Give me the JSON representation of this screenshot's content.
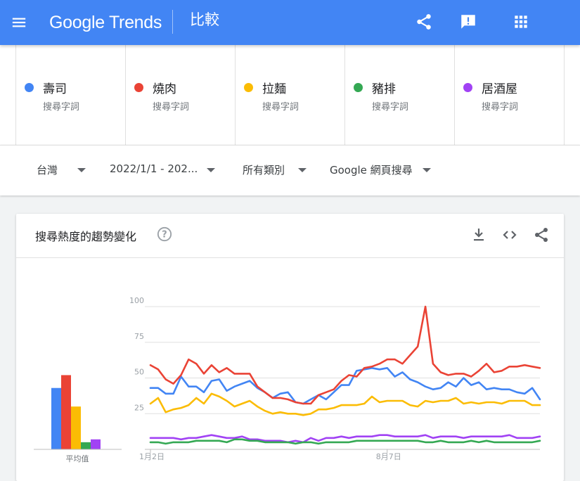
{
  "header": {
    "logo_text": "Google Trends",
    "page_title": "比較",
    "icons": [
      "menu-icon",
      "share-icon",
      "feedback-icon",
      "apps-icon"
    ]
  },
  "terms": [
    {
      "name": "壽司",
      "sub": "搜尋字詞",
      "color": "#4285f4"
    },
    {
      "name": "燒肉",
      "sub": "搜尋字詞",
      "color": "#ea4335"
    },
    {
      "name": "拉麵",
      "sub": "搜尋字詞",
      "color": "#fbbc04"
    },
    {
      "name": "豬排",
      "sub": "搜尋字詞",
      "color": "#34a853"
    },
    {
      "name": "居酒屋",
      "sub": "搜尋字詞",
      "color": "#a142f4"
    }
  ],
  "filters": [
    {
      "label": "台灣"
    },
    {
      "label": "2022/1/1 - 202..."
    },
    {
      "label": "所有類別"
    },
    {
      "label": "Google 網頁搜尋"
    }
  ],
  "card": {
    "title": "搜尋熱度的趨勢變化",
    "icons": [
      "help-icon",
      "download-icon",
      "embed-icon",
      "share-icon"
    ]
  },
  "chart_data": {
    "type": "line",
    "ylim": [
      0,
      100
    ],
    "yticks": [
      25,
      50,
      75,
      100
    ],
    "x_labels": [
      {
        "index": 0,
        "text": "1月2日"
      },
      {
        "index": 31,
        "text": "8月7日"
      }
    ],
    "averages_label": "平均值",
    "averages": [
      43,
      52,
      30,
      5,
      7
    ],
    "series": [
      {
        "name": "壽司",
        "color": "#4285f4",
        "values": [
          43,
          43,
          39,
          39,
          51,
          44,
          44,
          40,
          48,
          49,
          41,
          44,
          46,
          48,
          43,
          40,
          36,
          39,
          40,
          33,
          32,
          35,
          38,
          35,
          40,
          45,
          45,
          55,
          56,
          57,
          56,
          57,
          51,
          54,
          49,
          47,
          44,
          42,
          43,
          47,
          44,
          50,
          45,
          47,
          42,
          43,
          42,
          42,
          40,
          39,
          43,
          35
        ]
      },
      {
        "name": "燒肉",
        "color": "#ea4335",
        "values": [
          59,
          56,
          49,
          46,
          52,
          63,
          60,
          53,
          59,
          54,
          57,
          53,
          53,
          53,
          44,
          40,
          36,
          36,
          35,
          33,
          32,
          32,
          38,
          40,
          42,
          48,
          52,
          51,
          57,
          58,
          60,
          63,
          63,
          60,
          66,
          72,
          100,
          60,
          54,
          52,
          53,
          53,
          51,
          55,
          60,
          54,
          55,
          58,
          58,
          59,
          58,
          57
        ]
      },
      {
        "name": "拉麵",
        "color": "#fbbc04",
        "values": [
          32,
          36,
          26,
          28,
          29,
          31,
          36,
          32,
          39,
          37,
          34,
          30,
          32,
          34,
          30,
          27,
          25,
          26,
          25,
          25,
          24,
          25,
          28,
          28,
          29,
          31,
          31,
          31,
          32,
          37,
          33,
          34,
          34,
          34,
          31,
          30,
          34,
          33,
          34,
          34,
          36,
          32,
          33,
          32,
          33,
          33,
          32,
          34,
          34,
          34,
          31,
          31
        ]
      },
      {
        "name": "豬排",
        "color": "#34a853",
        "values": [
          5,
          5,
          4,
          5,
          5,
          5,
          6,
          6,
          6,
          6,
          5,
          7,
          7,
          6,
          6,
          5,
          5,
          5,
          5,
          4,
          5,
          5,
          4,
          5,
          5,
          5,
          5,
          6,
          6,
          6,
          6,
          6,
          6,
          6,
          6,
          6,
          5,
          5,
          6,
          5,
          5,
          5,
          6,
          5,
          6,
          5,
          5,
          5,
          5,
          5,
          5,
          6
        ]
      },
      {
        "name": "居酒屋",
        "color": "#a142f4",
        "values": [
          8,
          8,
          8,
          8,
          7,
          8,
          8,
          9,
          10,
          9,
          8,
          8,
          9,
          7,
          7,
          6,
          6,
          6,
          5,
          6,
          5,
          8,
          6,
          8,
          8,
          9,
          8,
          9,
          9,
          9,
          10,
          10,
          9,
          9,
          9,
          9,
          10,
          8,
          9,
          9,
          9,
          8,
          9,
          9,
          9,
          9,
          9,
          10,
          8,
          8,
          8,
          9
        ]
      }
    ]
  }
}
